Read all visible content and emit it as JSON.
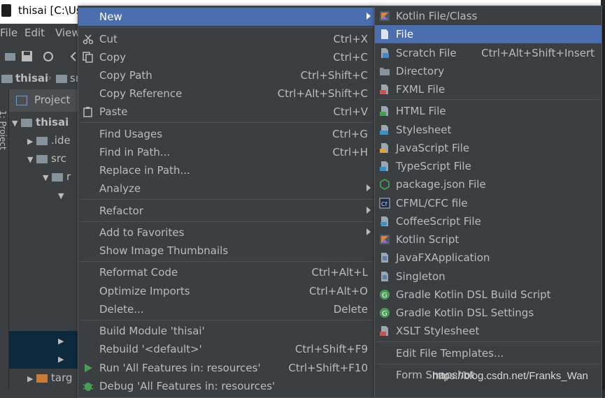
{
  "window": {
    "title": "thisai [C:\\Use"
  },
  "menubar": [
    "File",
    "Edit",
    "View"
  ],
  "navbar": {
    "project": "thisai",
    "next": "sr"
  },
  "left_strip": {
    "label": "1: Project"
  },
  "project_panel": {
    "title": "Project",
    "tree": [
      {
        "label": "thisai",
        "depth": 0
      },
      {
        "label": ".ide",
        "depth": 1
      },
      {
        "label": "src",
        "depth": 1
      },
      {
        "label": "r",
        "depth": 2
      },
      {
        "label": "",
        "depth": 3
      },
      {
        "label": "targ",
        "depth": 1
      }
    ]
  },
  "context_menu": {
    "new": {
      "label": "New"
    },
    "cut": {
      "label": "Cut",
      "shortcut": "Ctrl+X"
    },
    "copy": {
      "label": "Copy",
      "shortcut": "Ctrl+C"
    },
    "copy_path": {
      "label": "Copy Path",
      "shortcut": "Ctrl+Shift+C"
    },
    "copy_reference": {
      "label": "Copy Reference",
      "shortcut": "Ctrl+Alt+Shift+C"
    },
    "paste": {
      "label": "Paste",
      "shortcut": "Ctrl+V"
    },
    "find_usages": {
      "label": "Find Usages",
      "shortcut": "Ctrl+G"
    },
    "find_in_path": {
      "label": "Find in Path...",
      "shortcut": "Ctrl+H"
    },
    "replace_in_path": {
      "label": "Replace in Path..."
    },
    "analyze": {
      "label": "Analyze"
    },
    "refactor": {
      "label": "Refactor"
    },
    "add_to_favorites": {
      "label": "Add to Favorites"
    },
    "show_image_thumbnails": {
      "label": "Show Image Thumbnails"
    },
    "reformat_code": {
      "label": "Reformat Code",
      "shortcut": "Ctrl+Alt+L"
    },
    "optimize_imports": {
      "label": "Optimize Imports",
      "shortcut": "Ctrl+Alt+O"
    },
    "delete": {
      "label": "Delete...",
      "shortcut": "Delete"
    },
    "build_module": {
      "label": "Build Module 'thisai'"
    },
    "rebuild": {
      "label": "Rebuild '<default>'",
      "shortcut": "Ctrl+Shift+F9"
    },
    "run": {
      "label": "Run 'All Features in: resources'",
      "shortcut": "Ctrl+Shift+F10"
    },
    "debug": {
      "label": "Debug 'All Features in: resources'"
    }
  },
  "new_submenu": {
    "kotlin_file_class": {
      "label": "Kotlin File/Class",
      "icon": "kotlin-icon"
    },
    "file": {
      "label": "File",
      "icon": "file-icon"
    },
    "scratch_file": {
      "label": "Scratch File",
      "shortcut": "Ctrl+Alt+Shift+Insert",
      "icon": "scratch-file-icon"
    },
    "directory": {
      "label": "Directory",
      "icon": "folder-icon"
    },
    "fxml_file": {
      "label": "FXML File",
      "icon": "fxml-icon"
    },
    "html_file": {
      "label": "HTML File",
      "icon": "html-icon"
    },
    "stylesheet": {
      "label": "Stylesheet",
      "icon": "css-icon"
    },
    "javascript_file": {
      "label": "JavaScript File",
      "icon": "js-icon"
    },
    "typescript_file": {
      "label": "TypeScript File",
      "icon": "ts-icon"
    },
    "package_json_file": {
      "label": "package.json File",
      "icon": "nodejs-icon"
    },
    "cfml_cfc_file": {
      "label": "CFML/CFC file",
      "icon": "cfml-icon"
    },
    "coffeescript_file": {
      "label": "CoffeeScript File",
      "icon": "coffeescript-icon"
    },
    "kotlin_script": {
      "label": "Kotlin Script",
      "icon": "kotlin-icon"
    },
    "javafx_application": {
      "label": "JavaFXApplication",
      "icon": "javafx-icon"
    },
    "singleton": {
      "label": "Singleton",
      "icon": "singleton-icon"
    },
    "gradle_kotlin_build": {
      "label": "Gradle Kotlin DSL Build Script",
      "icon": "gradle-icon"
    },
    "gradle_kotlin_settings": {
      "label": "Gradle Kotlin DSL Settings",
      "icon": "gradle-icon"
    },
    "xslt_stylesheet": {
      "label": "XSLT Stylesheet",
      "icon": "xslt-icon"
    },
    "edit_file_templates": {
      "label": "Edit File Templates..."
    },
    "form_snapshot": {
      "label": "Form Snapshot"
    }
  },
  "watermark": "https://blog.csdn.net/Franks_Wan",
  "colors": {
    "selection": "#4b6eaf",
    "menu_bg": "#3c3f41",
    "text": "#bbbbbb",
    "run": "#499c54"
  }
}
